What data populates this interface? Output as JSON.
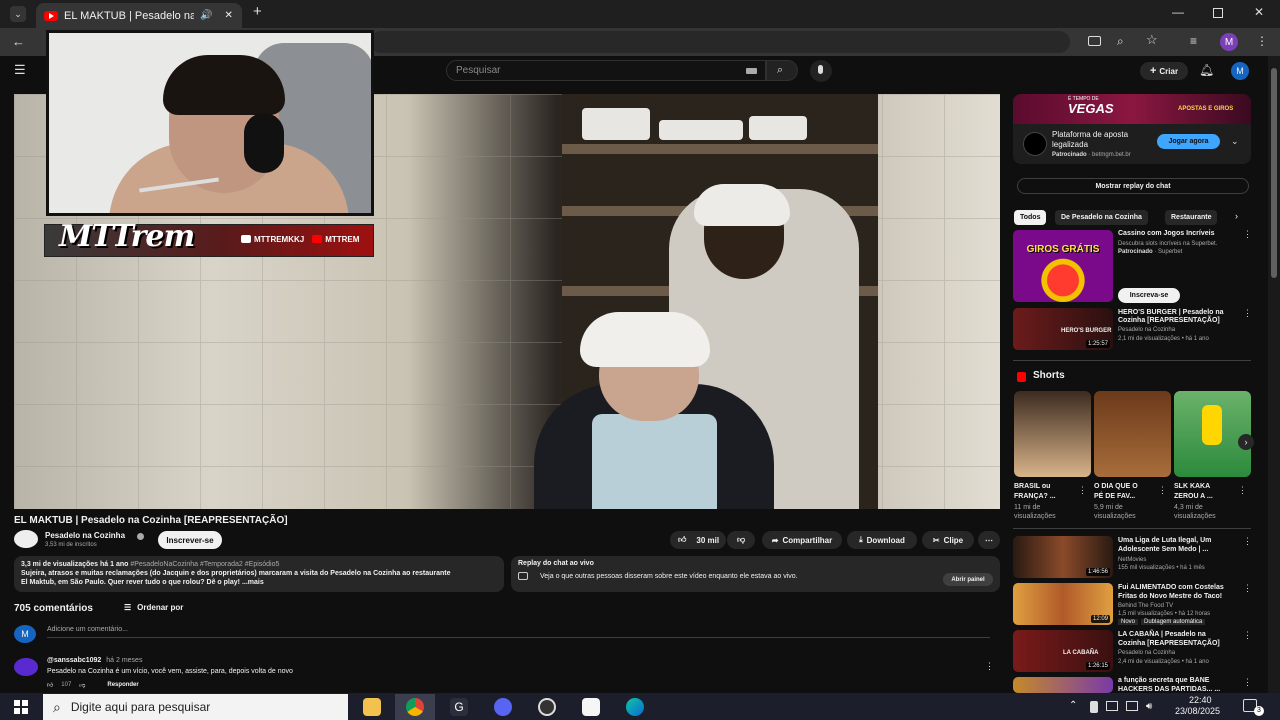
{
  "browser": {
    "tab_title": "EL MAKTUB | Pesadelo na C",
    "profile_initial": "M"
  },
  "youtube": {
    "search_placeholder": "Pesquisar",
    "create_label": "Criar",
    "avatar_initial": "M"
  },
  "stream_overlay": {
    "logo_text": "MTTrem",
    "tag1": "MTTREMKKJ",
    "tag2": "MTTREM"
  },
  "video": {
    "title": "EL MAKTUB | Pesadelo na Cozinha [REAPRESENTAÇÃO]",
    "channel_name": "Pesadelo na Cozinha",
    "subscribers": "3,53 mi de inscritos",
    "subscribe_label": "Inscrever-se",
    "likes": "30 mil",
    "share_label": "Compartilhar",
    "download_label": "Download",
    "clip_label": "Clipe",
    "views_date": "3,3 mi de visualizações  há 1 ano",
    "hashtags": "#PesadeloNaCozinha #Temporada2 #Episódio5",
    "description_line1": "Sujeira, atrasos e muitas reclamações (do Jacquin e dos proprietários) marcaram a visita do Pesadelo na Cozinha ao restaurante",
    "description_line2": "El Maktub, em São Paulo. Quer rever tudo o que rolou? Dê o play!",
    "more_label": "...mais",
    "chat_replay_title": "Replay do chat ao vivo",
    "chat_replay_text": "Veja o que outras pessoas disseram sobre este vídeo enquanto ele estava ao vivo.",
    "open_panel_label": "Abrir painel"
  },
  "comments": {
    "count_label": "705 comentários",
    "sort_label": "Ordenar por",
    "add_placeholder": "Adicione um comentário...",
    "user_initial": "M",
    "items": [
      {
        "author": "@sanssabc1092",
        "time": "há 2 meses",
        "text": "Pesadelo na Cozinha é um vício, você vem, assiste, para, depois volta de novo",
        "likes": "107",
        "reply_label": "Responder"
      }
    ]
  },
  "sidebar": {
    "ad": {
      "banner_text1": "É TEMPO DE",
      "banner_text2": "VEGAS",
      "banner_text3": "APOSTAS E GIROS",
      "headline": "Plataforma de aposta legalizada",
      "sponsor": "Patrocinado",
      "url": "betmgm.bet.br",
      "cta": "Jogar agora"
    },
    "chat_replay_button": "Mostrar replay do chat",
    "chips": [
      "Todos",
      "De Pesadelo na Cozinha",
      "Restaurante"
    ],
    "promo": {
      "thumb_text": "GIROS GRÁTIS",
      "title": "Cassino com Jogos Incríveis",
      "desc": "Descubra slots incríveis na Superbet.",
      "sponsor": "Patrocinado",
      "advertiser": "Superbet",
      "cta": "Inscreva-se"
    },
    "videos_top": [
      {
        "title_l1": "HERO'S BURGER | Pesadelo na",
        "title_l2": "Cozinha [REAPRESENTAÇÃO]",
        "channel": "Pesadelo na Cozinha",
        "meta": "2,1 mi de visualizações  •  há 1 ano",
        "duration": "1:25:57",
        "thumb_label": "HERO'S BURGER"
      }
    ],
    "shorts_label": "Shorts",
    "shorts": [
      {
        "l1": "BRASIL ou",
        "l2": "FRANÇA? ...",
        "m1": "11 mi de",
        "m2": "visualizações"
      },
      {
        "l1": "O DIA QUE O",
        "l2": "PÉ DE FAV...",
        "m1": "5,9 mi de",
        "m2": "visualizações"
      },
      {
        "l1": "SLK KAKA",
        "l2": "ZEROU A ...",
        "m1": "4,3 mi de",
        "m2": "visualizações"
      }
    ],
    "videos": [
      {
        "title_l1": "Uma Liga de Luta Ilegal, Um",
        "title_l2": "Adolescente Sem Medo  | ...",
        "channel": "NetMovies",
        "meta": "155 mil visualizações  •  há 1 mês",
        "duration": "1:46:56"
      },
      {
        "title_l1": "Fui ALIMENTADO com Costelas",
        "title_l2": "Fritas do Novo Mestre do Taco!",
        "channel": "Behind The Food TV",
        "meta": "1,5 mil visualizações  •  há 12 horas",
        "badge1": "Novo",
        "badge2": "Dublagem automática",
        "duration": "12:09"
      },
      {
        "title_l1": "LA CABAÑA | Pesadelo na",
        "title_l2": "Cozinha [REAPRESENTAÇÃO]",
        "channel": "Pesadelo na Cozinha",
        "meta": "2,4 mi de visualizações  •  há 1 ano",
        "duration": "1:26:15",
        "thumb_label": "LA CABAÑA"
      },
      {
        "title_l1": "a função secreta que BANE",
        "title_l2": "HACKERS DAS PARTIDAS... ...",
        "channel": "",
        "meta": "",
        "duration": ""
      }
    ]
  },
  "taskbar": {
    "search_placeholder": "Digite aqui para pesquisar",
    "time": "22:40",
    "date": "23/08/2025",
    "notif_count": "3"
  },
  "colors": {
    "youtube_red": "#ff0000",
    "background": "#0f0f0f",
    "surface": "#272727",
    "accent_blue": "#3ea6ff"
  }
}
